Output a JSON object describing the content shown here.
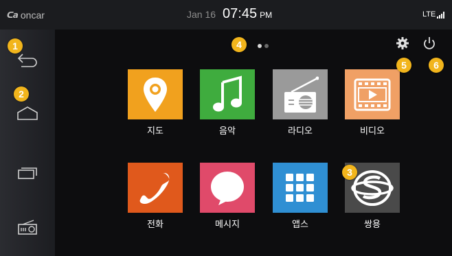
{
  "status": {
    "brand_logo": "ᑕa",
    "brand_name": "oncar",
    "date": "Jan 16",
    "time": "07:45",
    "ampm": "PM",
    "network": "LTE"
  },
  "icons": {
    "back": "back-arrow-icon",
    "home": "home-icon",
    "recent": "recent-apps-icon",
    "radio_side": "radio-icon",
    "settings": "gear-icon",
    "power": "power-icon"
  },
  "badges": [
    "1",
    "2",
    "3",
    "4",
    "5",
    "6"
  ],
  "badge_color": "#f2b51c",
  "pager": {
    "pages": 2,
    "current": 1
  },
  "apps": [
    {
      "label": "지도",
      "icon": "map-pin-icon",
      "color": "#f1a11e"
    },
    {
      "label": "음악",
      "icon": "music-note-icon",
      "color": "#3fac3e"
    },
    {
      "label": "라디오",
      "icon": "radio-icon",
      "color": "#9a9a9a"
    },
    {
      "label": "비디오",
      "icon": "video-icon",
      "color": "#f0a065"
    },
    {
      "label": "전화",
      "icon": "phone-icon",
      "color": "#e0591c"
    },
    {
      "label": "메시지",
      "icon": "message-icon",
      "color": "#e04a6a"
    },
    {
      "label": "앱스",
      "icon": "apps-grid-icon",
      "color": "#2f8fd3"
    },
    {
      "label": "쌍용",
      "icon": "ssangyong-logo-icon",
      "color": "#4a4a4a"
    }
  ]
}
